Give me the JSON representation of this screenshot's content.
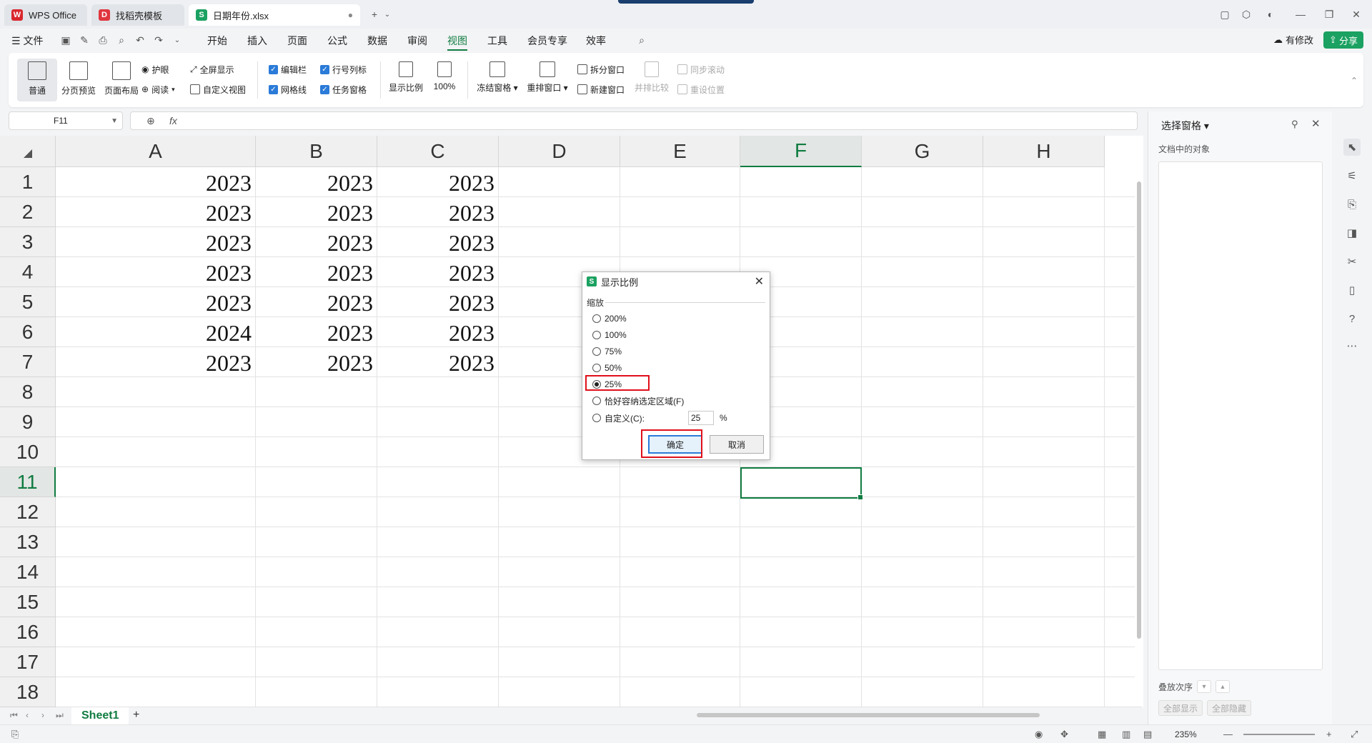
{
  "tabs": [
    {
      "label": "WPS Office",
      "logo": "W",
      "logo_color": "#d9272e"
    },
    {
      "label": "找稻壳模板",
      "logo": "D",
      "logo_color": "#e0363e"
    },
    {
      "label": "日期年份.xlsx",
      "logo": "S",
      "logo_color": "#1ba161"
    }
  ],
  "menu": {
    "file": "文件",
    "items": [
      "开始",
      "插入",
      "页面",
      "公式",
      "数据",
      "审阅",
      "视图",
      "工具",
      "会员专享",
      "效率"
    ],
    "active": "视图",
    "modify": "有修改",
    "share": "分享"
  },
  "ribbon": {
    "normal": "普通",
    "page_break": "分页预览",
    "page_layout": "页面布局",
    "eye_protect": "护眼",
    "reading": "阅读",
    "fullscreen": "全屏显示",
    "custom_view": "自定义视图",
    "edit_bar": "编辑栏",
    "gridlines": "网格线",
    "row_col_headers": "行号列标",
    "task_pane": "任务窗格",
    "zoom": "显示比例",
    "zoom100": "100%",
    "freeze": "冻结窗格",
    "rearrange": "重排窗口",
    "split": "拆分窗口",
    "new_window": "新建窗口",
    "side_by_side": "并排比较",
    "sync_scroll": "同步滚动",
    "reset_position": "重设位置"
  },
  "formula_bar": {
    "name_box": "F11",
    "fx": "fx"
  },
  "sheet": {
    "columns": [
      "A",
      "B",
      "C",
      "D",
      "E",
      "F",
      "G",
      "H"
    ],
    "selected_column": "F",
    "rows": [
      "1",
      "2",
      "3",
      "4",
      "5",
      "6",
      "7",
      "8",
      "9",
      "10",
      "11",
      "12",
      "13",
      "14",
      "15",
      "16",
      "17",
      "18"
    ],
    "selected_row": "11",
    "data": [
      [
        "2023",
        "2023",
        "2023"
      ],
      [
        "2023",
        "2023",
        "2023"
      ],
      [
        "2023",
        "2023",
        "2023"
      ],
      [
        "2023",
        "2023",
        "2023"
      ],
      [
        "2023",
        "2023",
        "2023"
      ],
      [
        "2024",
        "2023",
        "2023"
      ],
      [
        "2023",
        "2023",
        "2023"
      ]
    ],
    "tab_name": "Sheet1",
    "add": "+"
  },
  "status": {
    "zoom": "235%"
  },
  "right_panel": {
    "title": "选择窗格",
    "subtitle": "文档中的对象",
    "order": "叠放次序",
    "show_all": "全部显示",
    "hide_all": "全部隐藏"
  },
  "dialog": {
    "title": "显示比例",
    "group": "缩放",
    "options": [
      "200%",
      "100%",
      "75%",
      "50%",
      "25%",
      "恰好容纳选定区域(F)",
      "自定义(C):"
    ],
    "selected": "25%",
    "custom_value": "25",
    "percent": "%",
    "ok": "确定",
    "cancel": "取消"
  }
}
